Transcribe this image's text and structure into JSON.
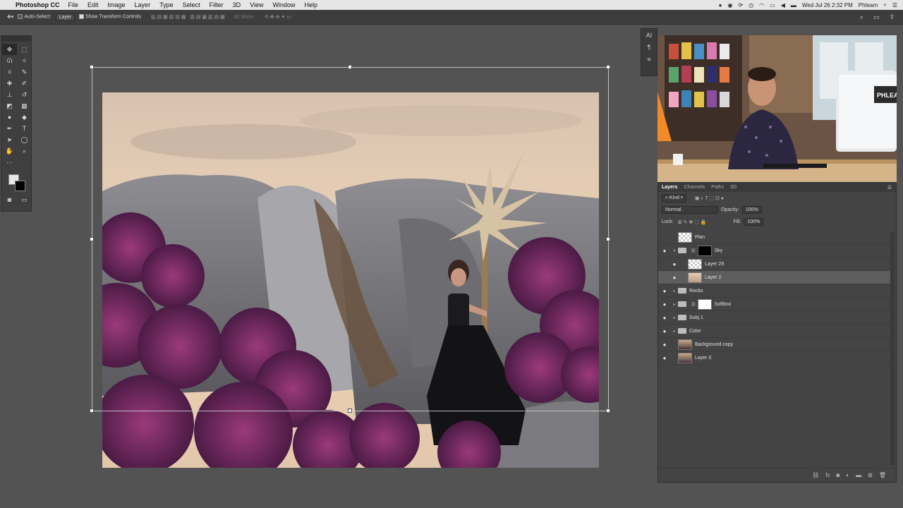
{
  "menubar": {
    "apple_icon": "apple-icon",
    "app_name": "Photoshop CC",
    "items": [
      "File",
      "Edit",
      "Image",
      "Layer",
      "Type",
      "Select",
      "Filter",
      "3D",
      "View",
      "Window",
      "Help"
    ],
    "datetime": "Wed Jul 26  2:32 PM",
    "user": "Phlearn"
  },
  "options": {
    "auto_select_label": "Auto-Select:",
    "auto_select_value": "Layer",
    "show_transform_label": "Show Transform Controls",
    "mode_3d_label": "3D Mode:"
  },
  "minibar": [
    "AI",
    "¶",
    "≡"
  ],
  "layers_panel": {
    "tabs": [
      "Layers",
      "Channels",
      "Paths",
      "3D"
    ],
    "filter_kind": "Kind",
    "blend_mode": "Normal",
    "opacity_label": "Opacity:",
    "opacity_value": "100%",
    "lock_label": "Lock:",
    "fill_label": "Fill:",
    "fill_value": "100%",
    "layers": [
      {
        "name": "Plan"
      },
      {
        "name": "Sky"
      },
      {
        "name": "Layer 29"
      },
      {
        "name": "Layer 2"
      },
      {
        "name": "Rocks"
      },
      {
        "name": "Softbox"
      },
      {
        "name": "Subj 1"
      },
      {
        "name": "Color"
      },
      {
        "name": "Background copy"
      },
      {
        "name": "Layer 0"
      }
    ]
  },
  "webcam": {
    "sign_text": "PHLEA"
  }
}
